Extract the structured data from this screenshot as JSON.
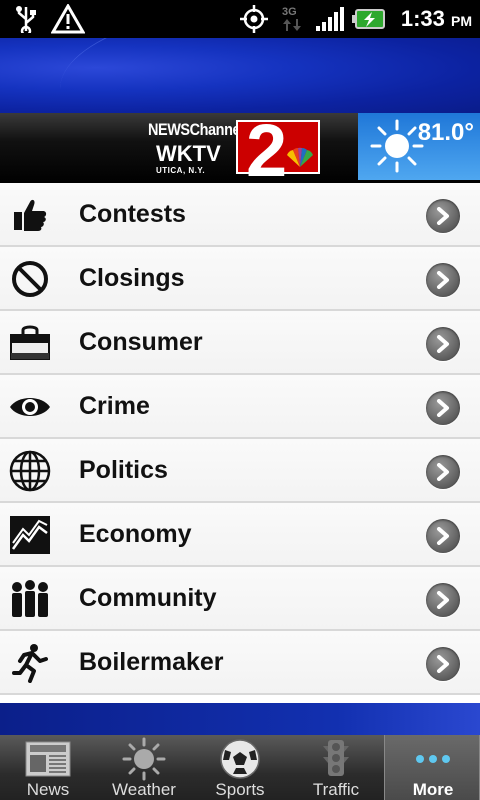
{
  "status_bar": {
    "time": "1:33",
    "ampm": "PM",
    "network": "3G"
  },
  "header": {
    "logo": {
      "line1": "NEWSChannel",
      "line2": "WKTV",
      "line3": "UTICA, N.Y.",
      "number": "2"
    },
    "weather": {
      "temperature": "81.0°",
      "icon": "sun-icon"
    }
  },
  "menu": {
    "items": [
      {
        "label": "Contests",
        "icon": "thumbs-up-icon"
      },
      {
        "label": "Closings",
        "icon": "no-sign-icon"
      },
      {
        "label": "Consumer",
        "icon": "shopping-bag-icon"
      },
      {
        "label": "Crime",
        "icon": "eye-icon"
      },
      {
        "label": "Politics",
        "icon": "globe-icon"
      },
      {
        "label": "Economy",
        "icon": "chart-icon"
      },
      {
        "label": "Community",
        "icon": "people-icon"
      },
      {
        "label": "Boilermaker",
        "icon": "runner-icon"
      }
    ]
  },
  "tabs": [
    {
      "label": "News",
      "icon": "newspaper-icon"
    },
    {
      "label": "Weather",
      "icon": "sun-icon"
    },
    {
      "label": "Sports",
      "icon": "soccer-ball-icon"
    },
    {
      "label": "Traffic",
      "icon": "traffic-light-icon"
    },
    {
      "label": "More",
      "icon": "more-dots-icon",
      "active": true
    }
  ],
  "colors": {
    "banner_blue": "#1533c0",
    "logo_red": "#cc0000",
    "weather_blue": "#2f86e0"
  }
}
